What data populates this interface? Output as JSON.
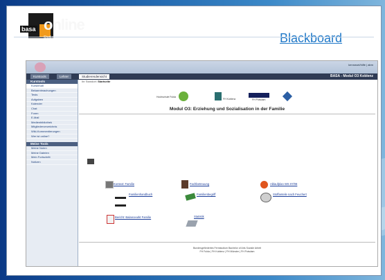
{
  "slide": {
    "logo": {
      "badge": "basa",
      "word": "online",
      "sub": "Studiengang Soziale Arbeit"
    },
    "title": "Blackboard"
  },
  "bb": {
    "toplinks": "kennwort/hilfe | abm",
    "tabs": [
      "Kurstools",
      "Lehrer",
      "Studierendensicht"
    ],
    "course_header": "BASA - Modul O3 Koblenz",
    "sidebar": {
      "section1": "Kurstools",
      "items1": [
        "Kursinhalt",
        "Bekanntmachungen",
        "Tests",
        "Aufgaben",
        "Kalender",
        "Chat",
        "Foren",
        "E-Mail",
        "Medienbibliothek",
        "Mitgliederverzeichnis",
        "Wiki-Kommentierungen",
        "Wer ist online?"
      ],
      "section2": "Meine Tools",
      "items2": [
        "Meine Noten",
        "Meine Dateien",
        "Mein Fortschritt",
        "Notizen"
      ]
    },
    "breadcrumb": {
      "prefix": "Ihr Standort:",
      "current": "Startseite"
    },
    "partners": [
      "Hochschule Fulda",
      "FH Koblenz",
      "FH Potsdam",
      "FH Potsdam",
      "FH Koblenz"
    ],
    "course_title": "Modul O3: Erziehung und Sozialisation in der Familie",
    "links": [
      "Kontext: Familie",
      "Fachbetreuung",
      "Ablaufplan WS 07/08",
      "Familienhandbuch",
      "Familienbegriff",
      "Stoffanteile nach Feuchert",
      "Bericht: Balancearkt Familie",
      "Statistik"
    ],
    "footer": [
      "Bundesgefördertes Fernstudium Bachelor of Arts Soziale Arbeit",
      "FH Fulda | FH Koblenz | FH Münster | FH Potsdam"
    ]
  }
}
